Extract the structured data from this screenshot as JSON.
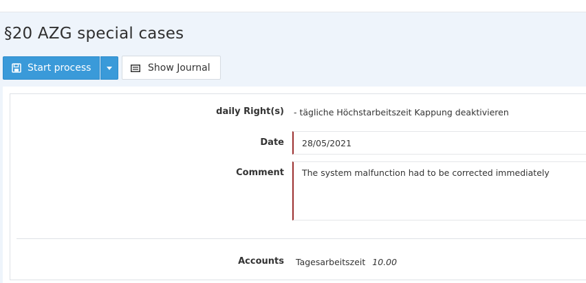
{
  "page": {
    "title": "§20 AZG special cases"
  },
  "toolbar": {
    "start_process_label": "Start process",
    "show_journal_label": "Show Journal"
  },
  "form": {
    "daily_rights": {
      "label": "daily Right(s)",
      "value": "- tägliche Höchstarbeitszeit Kappung deaktivieren"
    },
    "date": {
      "label": "Date",
      "value": "28/05/2021"
    },
    "comment": {
      "label": "Comment",
      "value": "The system malfunction had to be corrected immediately"
    },
    "accounts": {
      "label": "Accounts",
      "name": "Tagesarbeitszeit",
      "amount": "10.00"
    }
  },
  "colors": {
    "primary": "#3a9ad9",
    "background": "#eef4fb",
    "field_accent": "#9b2e2e"
  }
}
